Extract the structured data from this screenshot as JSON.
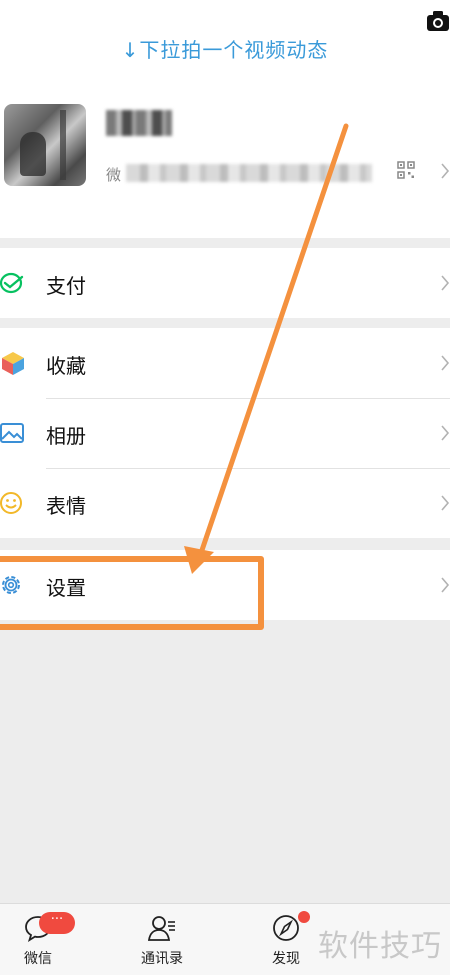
{
  "header": {
    "pull_hint": "↓下拉拍一个视频动态"
  },
  "profile": {
    "nickname": "",
    "wechat_id_prefix": "微"
  },
  "menu": {
    "pay": "支付",
    "favorites": "收藏",
    "album": "相册",
    "stickers": "表情",
    "settings": "设置"
  },
  "tabbar": {
    "chats": "微信",
    "chats_badge": "···",
    "contacts": "通讯录",
    "discover": "发现"
  },
  "watermark": "软件技巧",
  "colors": {
    "accent_blue": "#3a9ad9",
    "wechat_green": "#07c160",
    "annotation_orange": "#f4913e",
    "badge_red": "#f04a3f"
  },
  "icons": {
    "camera": "camera-icon",
    "qr": "qr-code-icon",
    "pay": "pay-icon",
    "favorites": "cube-icon",
    "album": "image-icon",
    "stickers": "smiley-icon",
    "settings": "gear-icon",
    "chats": "chat-bubble-icon",
    "contacts": "contacts-icon",
    "discover": "compass-icon"
  }
}
